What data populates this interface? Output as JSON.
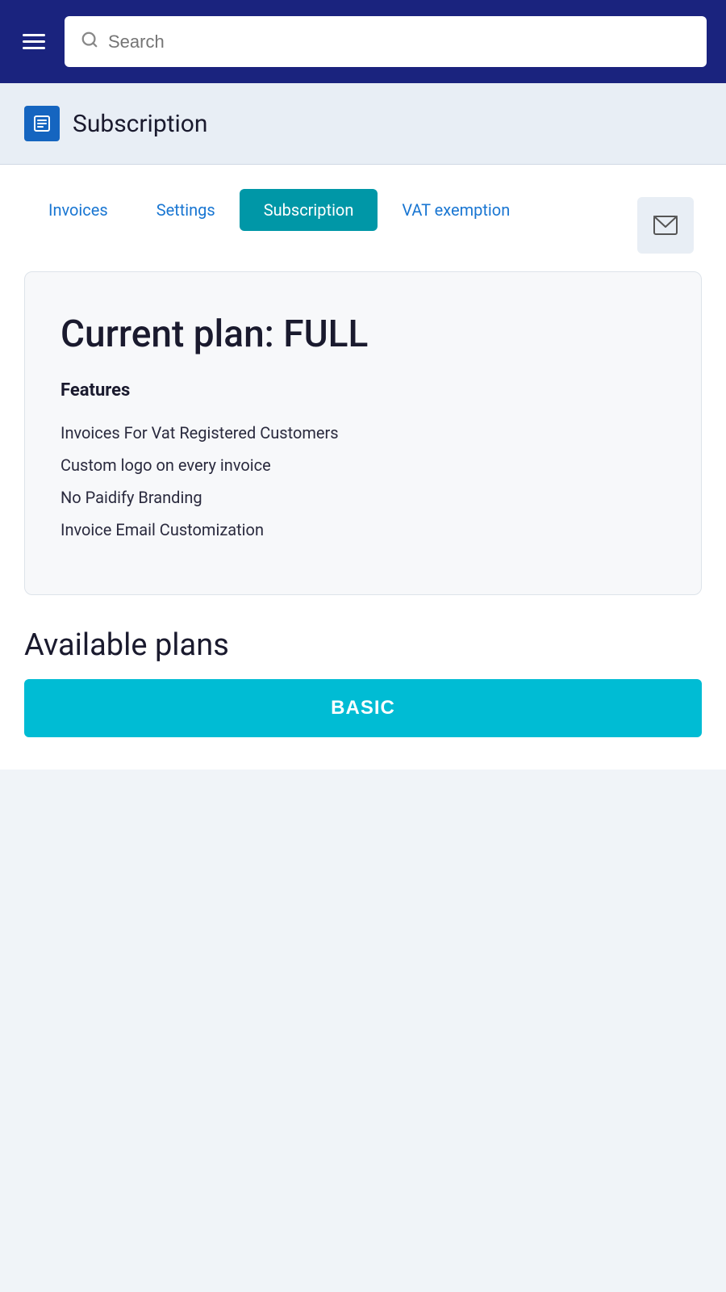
{
  "header": {
    "search_placeholder": "Search"
  },
  "page_title_bar": {
    "title": "Subscription",
    "icon_label": "subscription-icon"
  },
  "tabs": [
    {
      "label": "Invoices",
      "active": false,
      "id": "tab-invoices"
    },
    {
      "label": "Settings",
      "active": false,
      "id": "tab-settings"
    },
    {
      "label": "Subscription",
      "active": true,
      "id": "tab-subscription"
    },
    {
      "label": "VAT exemption",
      "active": false,
      "id": "tab-vat-exemption"
    }
  ],
  "current_plan": {
    "title": "Current plan: FULL",
    "features_heading": "Features",
    "features": [
      "Invoices For Vat Registered Customers",
      "Custom logo on every invoice",
      "No Paidify Branding",
      "Invoice Email Customization"
    ]
  },
  "available_plans": {
    "title": "Available plans",
    "basic_label": "BASIC"
  }
}
